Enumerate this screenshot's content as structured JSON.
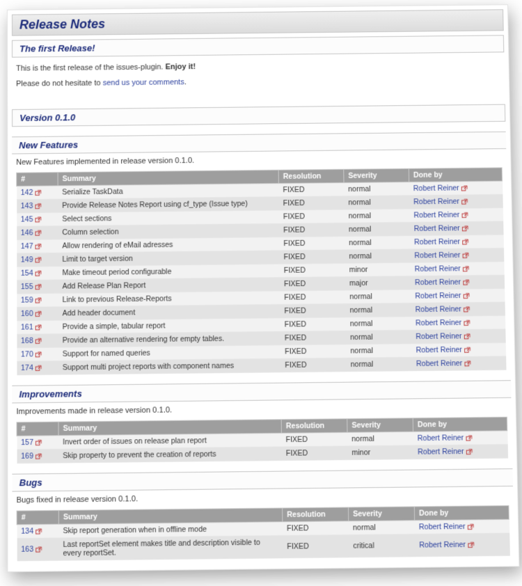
{
  "page_title": "Release Notes",
  "first_release": {
    "heading": "The first Release!",
    "line1_a": "This is the first release of the issues-plugin. ",
    "line1_b": "Enjoy it!",
    "line2_a": "Please do not hesitate to ",
    "line2_link": "send us your comments",
    "line2_b": "."
  },
  "version_heading": "Version 0.1.0",
  "columns": {
    "id": "#",
    "summary": "Summary",
    "resolution": "Resolution",
    "severity": "Severity",
    "doneby": "Done by"
  },
  "new_features": {
    "heading": "New Features",
    "caption": "New Features implemented in release version 0.1.0.",
    "rows": [
      {
        "id": "142",
        "summary": "Serialize TaskData",
        "resolution": "FIXED",
        "severity": "normal",
        "doneby": "Robert Reiner"
      },
      {
        "id": "143",
        "summary": "Provide Release Notes Report using cf_type (Issue type)",
        "resolution": "FIXED",
        "severity": "normal",
        "doneby": "Robert Reiner"
      },
      {
        "id": "145",
        "summary": "Select sections",
        "resolution": "FIXED",
        "severity": "normal",
        "doneby": "Robert Reiner"
      },
      {
        "id": "146",
        "summary": "Column selection",
        "resolution": "FIXED",
        "severity": "normal",
        "doneby": "Robert Reiner"
      },
      {
        "id": "147",
        "summary": "Allow rendering of eMail adresses",
        "resolution": "FIXED",
        "severity": "normal",
        "doneby": "Robert Reiner"
      },
      {
        "id": "149",
        "summary": "Limit to target version",
        "resolution": "FIXED",
        "severity": "normal",
        "doneby": "Robert Reiner"
      },
      {
        "id": "154",
        "summary": "Make timeout period configurable",
        "resolution": "FIXED",
        "severity": "minor",
        "doneby": "Robert Reiner"
      },
      {
        "id": "155",
        "summary": "Add Release Plan Report",
        "resolution": "FIXED",
        "severity": "major",
        "doneby": "Robert Reiner"
      },
      {
        "id": "159",
        "summary": "Link to previous Release-Reports",
        "resolution": "FIXED",
        "severity": "normal",
        "doneby": "Robert Reiner"
      },
      {
        "id": "160",
        "summary": "Add header document",
        "resolution": "FIXED",
        "severity": "normal",
        "doneby": "Robert Reiner"
      },
      {
        "id": "161",
        "summary": "Provide a simple, tabular report",
        "resolution": "FIXED",
        "severity": "normal",
        "doneby": "Robert Reiner"
      },
      {
        "id": "168",
        "summary": "Provide an alternative rendering for empty tables.",
        "resolution": "FIXED",
        "severity": "normal",
        "doneby": "Robert Reiner"
      },
      {
        "id": "170",
        "summary": "Support for named queries",
        "resolution": "FIXED",
        "severity": "normal",
        "doneby": "Robert Reiner"
      },
      {
        "id": "174",
        "summary": "Support multi project reports with component names",
        "resolution": "FIXED",
        "severity": "normal",
        "doneby": "Robert Reiner"
      }
    ]
  },
  "improvements": {
    "heading": "Improvements",
    "caption": "Improvements made in release version 0.1.0.",
    "rows": [
      {
        "id": "157",
        "summary": "Invert order of issues on release plan report",
        "resolution": "FIXED",
        "severity": "normal",
        "doneby": "Robert Reiner"
      },
      {
        "id": "169",
        "summary": "Skip property to prevent the creation of reports",
        "resolution": "FIXED",
        "severity": "minor",
        "doneby": "Robert Reiner"
      }
    ]
  },
  "bugs": {
    "heading": "Bugs",
    "caption": "Bugs fixed in release version 0.1.0.",
    "rows": [
      {
        "id": "134",
        "summary": "Skip report generation when in offline mode",
        "resolution": "FIXED",
        "severity": "normal",
        "doneby": "Robert Reiner"
      },
      {
        "id": "163",
        "summary": "Last reportSet element makes title and description visible to every reportSet.",
        "resolution": "FIXED",
        "severity": "critical",
        "doneby": "Robert Reiner"
      }
    ]
  }
}
